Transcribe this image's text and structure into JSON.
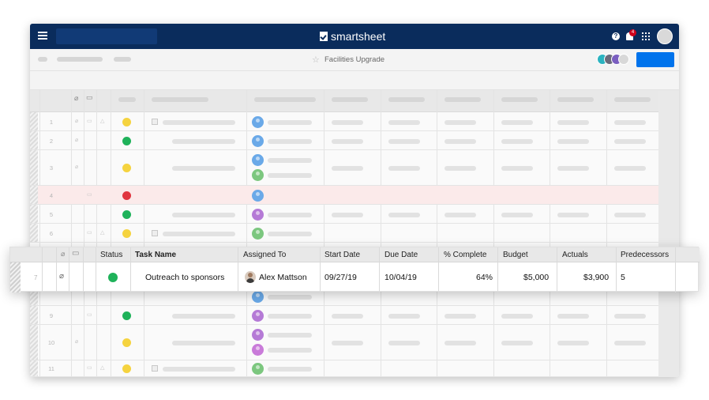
{
  "topbar": {
    "brand_name": "smartsheet",
    "icons": [
      "menu-icon",
      "help-icon",
      "bell-icon",
      "apps-grid-icon",
      "avatar"
    ],
    "notification_count": "4",
    "color": "#0a2c5c"
  },
  "toolbar": {
    "sheet_name": "Facilities Upgrade",
    "share_button_color": "#0073ec"
  },
  "status_colors": {
    "green": "#1fb25a",
    "yellow": "#f5d33f",
    "red": "#e0353f"
  },
  "grid_rows": [
    {
      "num": "1"
    },
    {
      "num": "2"
    },
    {
      "num": "3"
    },
    {
      "num": "4"
    },
    {
      "num": "5"
    },
    {
      "num": "6"
    },
    {
      "num": "9"
    },
    {
      "num": "10"
    },
    {
      "num": "11"
    }
  ],
  "detail": {
    "headers": {
      "status": "Status",
      "task_name": "Task Name",
      "assigned_to": "Assigned To",
      "start_date": "Start Date",
      "due_date": "Due Date",
      "percent_complete": "% Complete",
      "budget": "Budget",
      "actuals": "Actuals",
      "predecessors": "Predecessors"
    },
    "row": {
      "num": "7",
      "status_color": "#1fb25a",
      "task_name": "Outreach to sponsors",
      "assigned_to": "Alex Mattson",
      "start_date": "09/27/19",
      "due_date": "10/04/19",
      "percent_complete": "64%",
      "budget": "$5,000",
      "actuals": "$3,900",
      "predecessors": "5"
    }
  }
}
